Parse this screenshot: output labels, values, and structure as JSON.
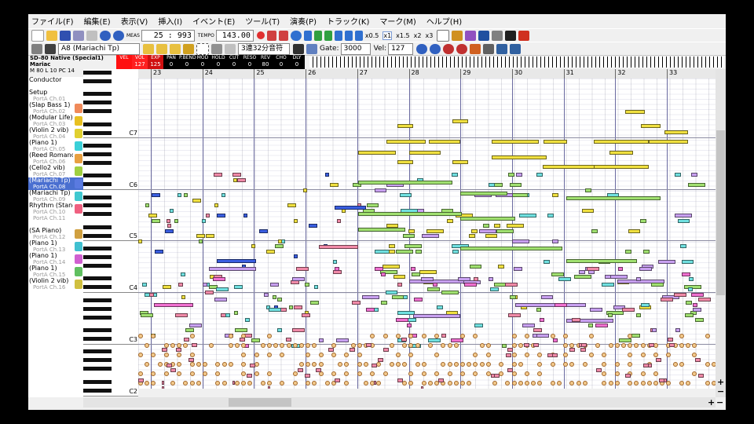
{
  "menu": [
    "ファイル(F)",
    "編集(E)",
    "表示(V)",
    "挿入(I)",
    "イベント(E)",
    "ツール(T)",
    "演奏(P)",
    "トラック(K)",
    "マーク(M)",
    "ヘルプ(H)"
  ],
  "transport": {
    "meas_label": "MEAS",
    "position": "25 : 993",
    "tempo_label": "TEMPO",
    "tempo": "143.00",
    "speeds": [
      "x0.5",
      "x1",
      "x1.5",
      "x2",
      "x3"
    ],
    "selected_speed": "x1"
  },
  "track_select": "A8 (Mariachi Tp)",
  "note_length": "3連32分音符",
  "gate_label": "Gate:",
  "gate_value": "3000",
  "vel_label": "Vel:",
  "vel_value": "127",
  "device": {
    "name": "SD-80 Native (Special1)",
    "instrument": "Mariac",
    "msb": "M 80",
    "lsb": "L 10",
    "pc": "PC 14"
  },
  "controls": [
    {
      "name": "VEL",
      "value": ""
    },
    {
      "name": "VOL",
      "value": "127"
    },
    {
      "name": "EXP",
      "value": "125"
    },
    {
      "name": "PAN",
      "value": "0"
    },
    {
      "name": "P.BEND",
      "value": "0"
    },
    {
      "name": "MOD",
      "value": "0"
    },
    {
      "name": "HOLD",
      "value": "0"
    },
    {
      "name": "CUT",
      "value": "0"
    },
    {
      "name": "RESO",
      "value": "0"
    },
    {
      "name": "REV",
      "value": "80"
    },
    {
      "name": "CHO",
      "value": "0"
    },
    {
      "name": "DLY",
      "value": "0"
    }
  ],
  "tracks": [
    {
      "name": "Conductor",
      "port": "",
      "icon": ""
    },
    {
      "name": "Setup",
      "port": "PortA  Ch.01",
      "icon": ""
    },
    {
      "name": "(Slap Bass 1)",
      "port": "PortA  Ch.02",
      "icon": "#f08a5a"
    },
    {
      "name": "(Modular Life)",
      "port": "PortA  Ch.03",
      "icon": "#e8c020"
    },
    {
      "name": "(Violin 2 vib)",
      "port": "PortA  Ch.04",
      "icon": "#e0d030"
    },
    {
      "name": "(Piano 1)",
      "port": "PortA  Ch.05",
      "icon": "#3ad0d8"
    },
    {
      "name": "(Reed Romance)",
      "port": "PortA  Ch.06",
      "icon": "#e8a040"
    },
    {
      "name": "(Cello2 vib)",
      "port": "PortA  Ch.07",
      "icon": "#a0d040"
    },
    {
      "name": "(Mariachi Tp)",
      "port": "PortA  Ch.08",
      "icon": "#5a7ae0",
      "selected": true
    },
    {
      "name": "(Mariachi Tp)",
      "port": "PortA  Ch.09",
      "icon": "#40c8d0"
    },
    {
      "name": "Rhythm (Standard)",
      "port": "PortA  Ch.10",
      "icon": "#f06080"
    },
    {
      "name": "",
      "port": "PortA  Ch.11",
      "icon": ""
    },
    {
      "name": "(SA Piano)",
      "port": "PortA  Ch.12",
      "icon": "#d0a040"
    },
    {
      "name": "(Piano 1)",
      "port": "PortA  Ch.13",
      "icon": "#40c0d0"
    },
    {
      "name": "(Piano 1)",
      "port": "PortA  Ch.14",
      "icon": "#d060d0"
    },
    {
      "name": "(Piano 1)",
      "port": "PortA  Ch.15",
      "icon": "#60c060"
    },
    {
      "name": "(Violin 2 vib)",
      "port": "PortA  Ch.16",
      "icon": "#d0c040"
    }
  ],
  "measures": [
    "23",
    "24",
    "25",
    "26",
    "27",
    "28",
    "29",
    "30",
    "31",
    "32",
    "33"
  ],
  "octaves": [
    "C7",
    "C6",
    "C5",
    "C4",
    "C3",
    "C2"
  ],
  "note_colors": {
    "yellow": "#f0e040",
    "green": "#a0e070",
    "cyan": "#70e0e0",
    "blue": "#3a5ee0",
    "pink": "#f08aa8",
    "violet": "#c8a0f0",
    "magenta": "#f070d0",
    "drum": "#f3c98b"
  }
}
